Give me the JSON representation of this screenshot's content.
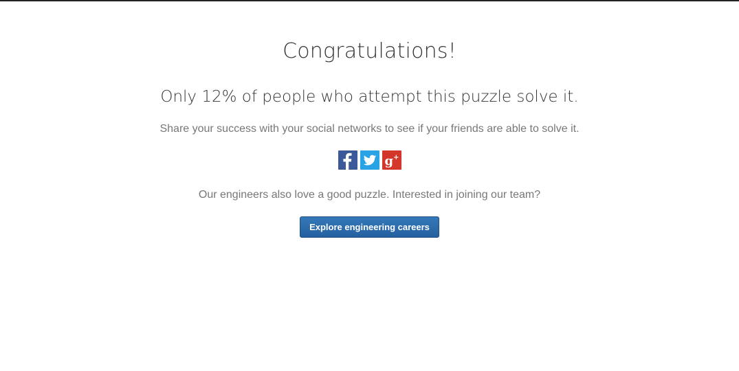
{
  "page": {
    "title": "Congratulations!",
    "subtitle": "Only 12% of people who attempt this puzzle solve it.",
    "share_text": "Share your success with your social networks to see if your friends are able to solve it.",
    "engineers_text": "Our engineers also love a good puzzle. Interested in joining our team?"
  },
  "social": {
    "facebook_icon": "facebook-icon",
    "twitter_icon": "twitter-icon",
    "googleplus_icon": "google-plus-icon",
    "googleplus_glyph": "g",
    "googleplus_plus": "+",
    "colors": {
      "facebook": "#3b5998",
      "twitter": "#2aa3e6",
      "googleplus": "#d2372a"
    }
  },
  "cta": {
    "label": "Explore engineering careers",
    "color": "#2a6aad"
  }
}
